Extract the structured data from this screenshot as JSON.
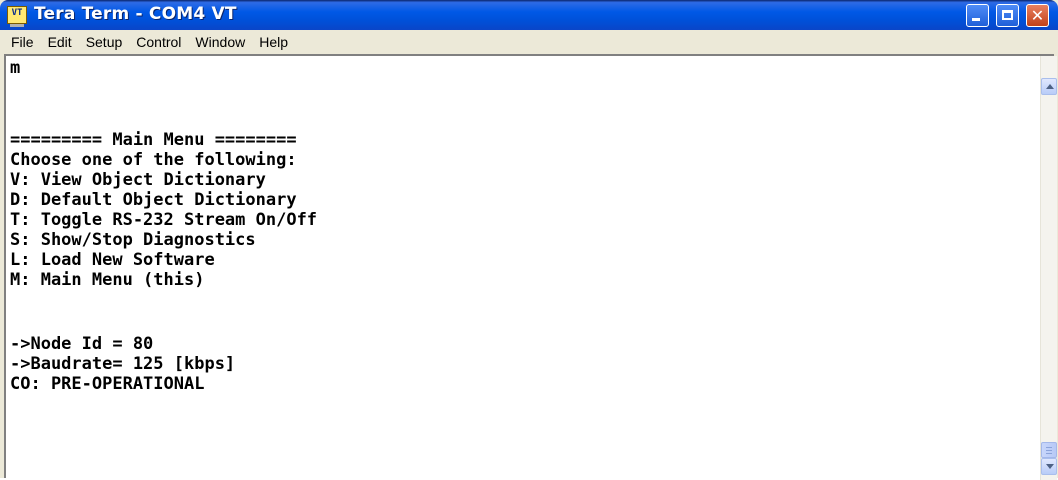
{
  "window": {
    "title": "Tera Term - COM4 VT",
    "icon_name": "tera-term-app-icon",
    "icon_text": "VT",
    "controls": {
      "minimize": "minimize-icon",
      "maximize": "maximize-icon",
      "close_glyph": "✕"
    }
  },
  "menubar": {
    "items": [
      "File",
      "Edit",
      "Setup",
      "Control",
      "Window",
      "Help"
    ]
  },
  "terminal": {
    "lines": [
      "m",
      "",
      "",
      "========= Main Menu ========",
      "Choose one of the following:",
      "V: View Object Dictionary",
      "D: Default Object Dictionary",
      "T: Toggle RS-232 Stream On/Off",
      "S: Show/Stop Diagnostics",
      "L: Load New Software",
      "M: Main Menu (this)",
      "",
      "->Node Id = 80",
      "->Baudrate= 125 [kbps]",
      "CO: PRE-OPERATIONAL"
    ]
  },
  "colors": {
    "titlebar": "#0058E6",
    "window_face": "#ECE9D8",
    "terminal_bg": "#FFFFFF",
    "terminal_fg": "#000000",
    "close_button": "#C2421A"
  }
}
